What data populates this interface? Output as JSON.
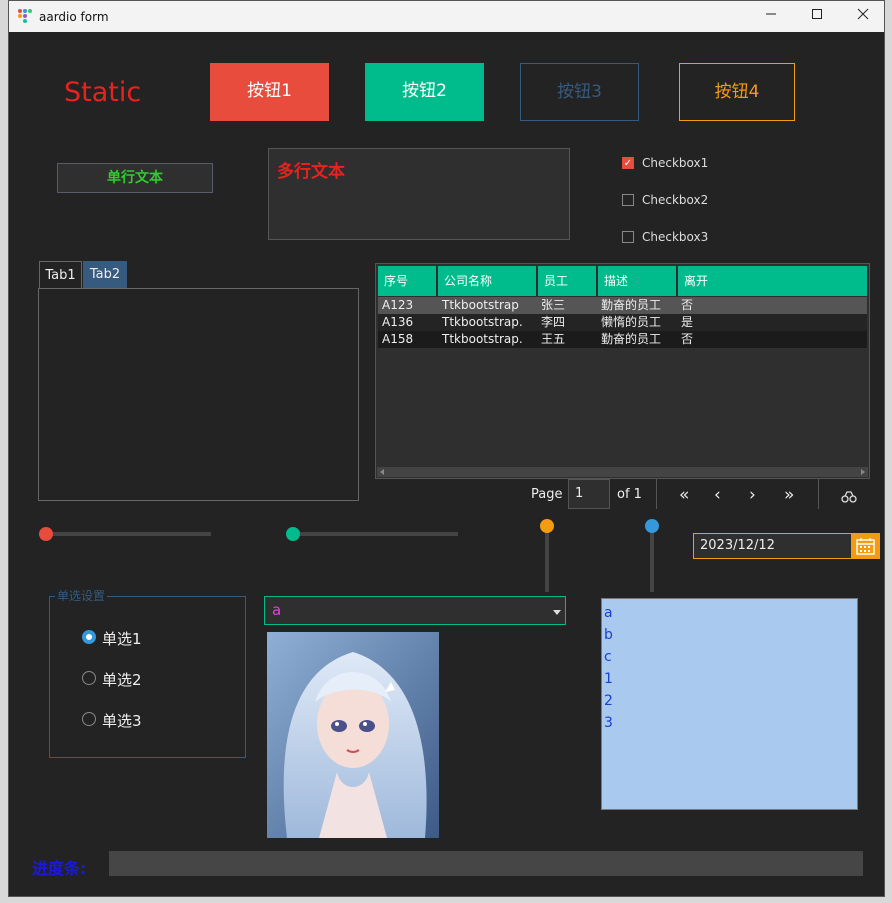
{
  "window": {
    "title": "aardio form",
    "controls": [
      "minimize",
      "maximize",
      "close"
    ]
  },
  "static_label": "Static",
  "buttons": [
    {
      "label": "按钮1",
      "color": "#e74c3c",
      "style": "solid"
    },
    {
      "label": "按钮2",
      "color": "#00bc8c",
      "style": "solid"
    },
    {
      "label": "按钮3",
      "color": "#375a7f",
      "style": "outline"
    },
    {
      "label": "按钮4",
      "color": "#f39c12",
      "style": "outline"
    }
  ],
  "single_line_text": "单行文本",
  "multi_line_text": "多行文本",
  "checkboxes": [
    {
      "label": "Checkbox1",
      "checked": true
    },
    {
      "label": "Checkbox2",
      "checked": false
    },
    {
      "label": "Checkbox3",
      "checked": false
    }
  ],
  "tabs": [
    {
      "label": "Tab1",
      "active": true
    },
    {
      "label": "Tab2",
      "active": false
    }
  ],
  "table": {
    "columns": [
      "序号",
      "公司名称",
      "员工",
      "描述",
      "离开"
    ],
    "rows": [
      [
        "A123",
        "Ttkbootstrap",
        "张三",
        "勤奋的员工",
        "否"
      ],
      [
        "A136",
        "Ttkbootstrap.",
        "李四",
        "懒惰的员工",
        "是"
      ],
      [
        "A158",
        "Ttkbootstrap.",
        "王五",
        "勤奋的员工",
        "否"
      ]
    ]
  },
  "pagination": {
    "page_label": "Page",
    "page_value": "1",
    "of_label": "of 1",
    "first": "«",
    "prev": "‹",
    "next": "›",
    "last": "»"
  },
  "sliders": [
    {
      "orientation": "horizontal",
      "value": 0.0,
      "color": "#e74c3c"
    },
    {
      "orientation": "horizontal",
      "value": 0.0,
      "color": "#00bc8c"
    },
    {
      "orientation": "vertical",
      "value": 1.0,
      "color": "#f39c12"
    },
    {
      "orientation": "vertical",
      "value": 1.0,
      "color": "#3498db"
    }
  ],
  "date_entry": {
    "value": "2023/12/12"
  },
  "radio_group": {
    "title": "单选设置",
    "options": [
      {
        "label": "单选1",
        "selected": true
      },
      {
        "label": "单选2",
        "selected": false
      },
      {
        "label": "单选3",
        "selected": false
      }
    ]
  },
  "combobox": {
    "value": "a"
  },
  "image": {
    "icon": "anime-girl-illustration"
  },
  "listbox": {
    "items": [
      "a",
      "b",
      "c",
      "1",
      "2",
      "3"
    ]
  },
  "progress": {
    "label": "进度条:",
    "value": 0
  }
}
